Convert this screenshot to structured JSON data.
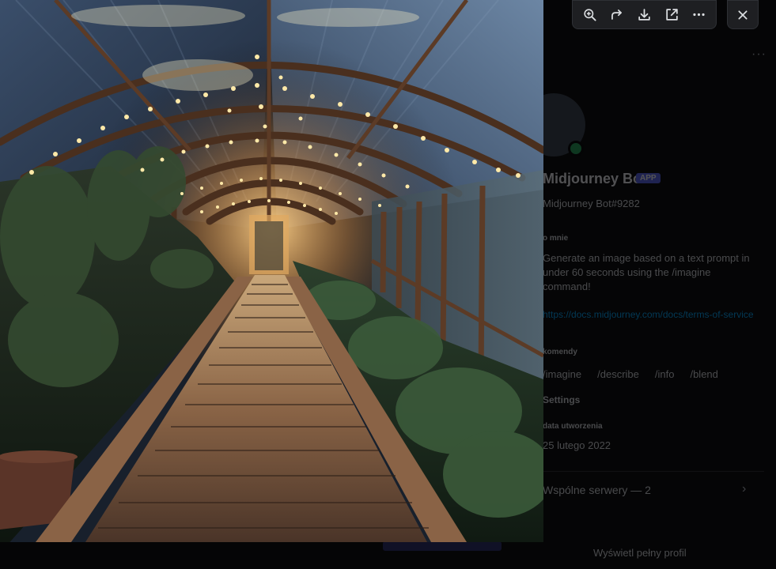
{
  "profile": {
    "bot_name": "Midjourney Bot",
    "badge": "APP",
    "username": "Midjourney Bot#9282",
    "about_heading": "O mnie",
    "about_text": "Generate an image based on a text prompt in under 60 seconds using the /imagine command!",
    "about_link": "https://docs.midjourney.com/docs/terms-of-service",
    "commands_heading": "Komendy",
    "commands": [
      "/imagine",
      "/describe",
      "/info",
      "/blend"
    ],
    "settings_label": "Settings",
    "created_heading": "Data utworzenia",
    "created_date": "25 lutego 2022",
    "mutual_servers": "Wspólne serwery — 2",
    "view_full_profile": "Wyświetl pełny profil"
  },
  "viewer": {
    "toolbar_icons": [
      "zoom-in-icon",
      "forward-icon",
      "download-icon",
      "open-in-browser-icon",
      "more-icon"
    ],
    "close_icon": "close-icon",
    "image_subject": "greenhouse-with-string-lights"
  },
  "colors": {
    "overlay_bg": "#050506",
    "toolbar_bg": "#1e1f22",
    "icon": "#dbdee1",
    "accent": "#5865f2",
    "online": "#23a55a",
    "link": "#00a8fc"
  }
}
